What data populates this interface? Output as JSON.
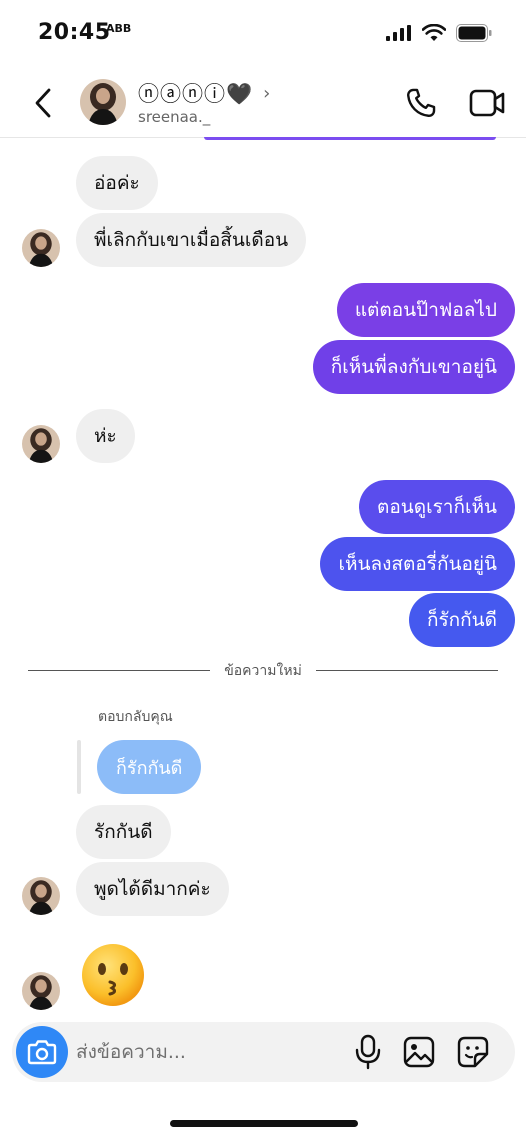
{
  "status_bar": {
    "time": "20:45",
    "extra": "ABB"
  },
  "header": {
    "contact_name": "ⓝⓐⓝⓘ🖤",
    "username": "sreenaa._"
  },
  "messages": [
    {
      "text": "อ่อค่ะ",
      "from": "them"
    },
    {
      "text": "พี่เลิกกับเขาเมื่อสิ้นเดือน",
      "from": "them"
    },
    {
      "text": "แต่ตอนป๊าฟอลไป",
      "from": "me"
    },
    {
      "text": "ก็เห็นพี่ลงกับเขาอยู่นิ",
      "from": "me"
    },
    {
      "text": "ห่ะ",
      "from": "them"
    },
    {
      "text": "ตอนดูเราก็เห็น",
      "from": "me"
    },
    {
      "text": "เห็นลงสตอรี่กันอยู่นิ",
      "from": "me"
    },
    {
      "text": "ก็รักกันดี",
      "from": "me"
    },
    {
      "text": "รักกันดี",
      "from": "them"
    },
    {
      "text": "พูดได้ดีมากค่ะ",
      "from": "them"
    }
  ],
  "divider_label": "ข้อความใหม่",
  "reply": {
    "label": "ตอบกลับคุณ",
    "quoted_text": "ก็รักกันดี"
  },
  "composer": {
    "placeholder": "ส่งข้อความ..."
  },
  "colors": {
    "bubble_out_top": "#7b3fe4",
    "bubble_out_bottom": "#4657ef",
    "bubble_in": "#efefef",
    "camera_button": "#2f88f6",
    "reply_bubble": "#8cbcf8"
  },
  "icons": {
    "back": "chevron-left-icon",
    "call": "phone-icon",
    "video": "video-camera-icon",
    "camera": "camera-icon",
    "mic": "microphone-icon",
    "gallery": "image-icon",
    "sticker": "sticker-icon",
    "emoji_message": "kissing-face-emoji"
  }
}
